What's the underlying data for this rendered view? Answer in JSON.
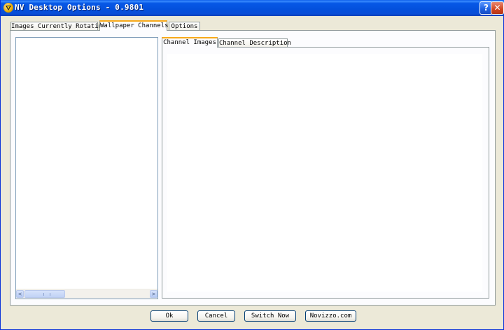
{
  "window": {
    "title": "NV Desktop Options - 0.9801"
  },
  "titlebar_buttons": {
    "help": "?",
    "close": "✕"
  },
  "main_tabs": [
    {
      "label": "Images Currently Rotating",
      "active": false
    },
    {
      "label": "Wallpaper Channels",
      "active": true
    },
    {
      "label": "Options",
      "active": false
    }
  ],
  "inner_tabs": [
    {
      "label": "Channel Images",
      "active": true
    },
    {
      "label": "Channel Description",
      "active": false
    }
  ],
  "scrollbar": {
    "left_arrow": "<",
    "right_arrow": ">"
  },
  "buttons": {
    "ok": "Ok",
    "cancel": "Cancel",
    "switch_now": "Switch Now",
    "novizzo": "Novizzo.com"
  },
  "colors": {
    "titlebar": "#0450dc",
    "active_tab_accent": "#f7a91a",
    "face": "#ece9d8"
  }
}
